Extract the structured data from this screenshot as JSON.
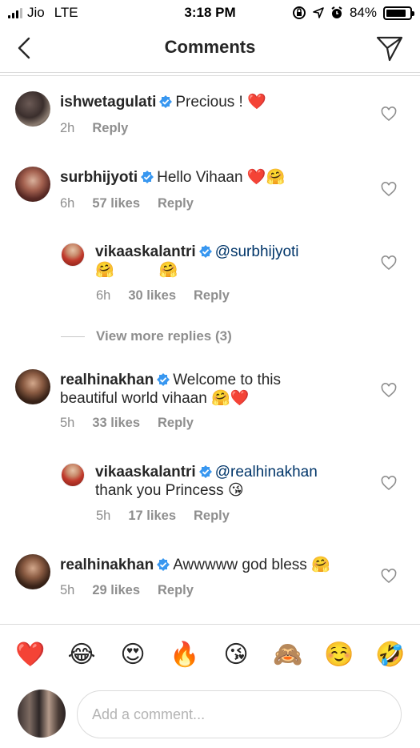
{
  "status_bar": {
    "carrier": "Jio",
    "network": "LTE",
    "time": "3:18 PM",
    "battery": "84%",
    "battery_level": 0.84
  },
  "header": {
    "title": "Comments",
    "back_icon": "chevron-left-icon",
    "send_icon": "paper-plane-icon"
  },
  "comments": [
    {
      "username": "ishwetagulati",
      "verified": true,
      "text": "Precious !",
      "emojis": "❤️",
      "time": "2h",
      "likes": "",
      "reply": "Reply"
    },
    {
      "username": "surbhijyoti",
      "verified": true,
      "text": "Hello Vihaan",
      "emojis": "❤️🤗",
      "time": "6h",
      "likes": "57 likes",
      "reply": "Reply"
    },
    {
      "username": "vikaaskalantri",
      "verified": true,
      "mention": "@surbhijyoti",
      "emojis": "🤗🤗",
      "time": "6h",
      "likes": "30 likes",
      "reply": "Reply"
    },
    {
      "username": "realhinakhan",
      "verified": true,
      "text_line1": "Welcome to this",
      "text_line2": "beautiful world vihaan",
      "emojis": "🤗❤️",
      "time": "5h",
      "likes": "33 likes",
      "reply": "Reply"
    },
    {
      "username": "vikaaskalantri",
      "verified": true,
      "mention": "@realhinakhan",
      "text": "thank you Princess",
      "emojis": "😘",
      "time": "5h",
      "likes": "17 likes",
      "reply": "Reply"
    },
    {
      "username": "realhinakhan",
      "verified": true,
      "text": "Awwwww god bless",
      "emojis": "🤗",
      "time": "5h",
      "likes": "29 likes",
      "reply": "Reply"
    }
  ],
  "view_more_replies": "View more replies (3)",
  "quick_emojis": [
    "❤️",
    "😂",
    "😍",
    "🔥",
    "😘",
    "🙈",
    "☺️",
    "🤣"
  ],
  "comment_input": {
    "placeholder": "Add a comment..."
  },
  "colors": {
    "verified_blue": "#3897f0",
    "meta_gray": "#8e8e8e",
    "mention_blue": "#003569",
    "heart_red": "#ed4956"
  }
}
